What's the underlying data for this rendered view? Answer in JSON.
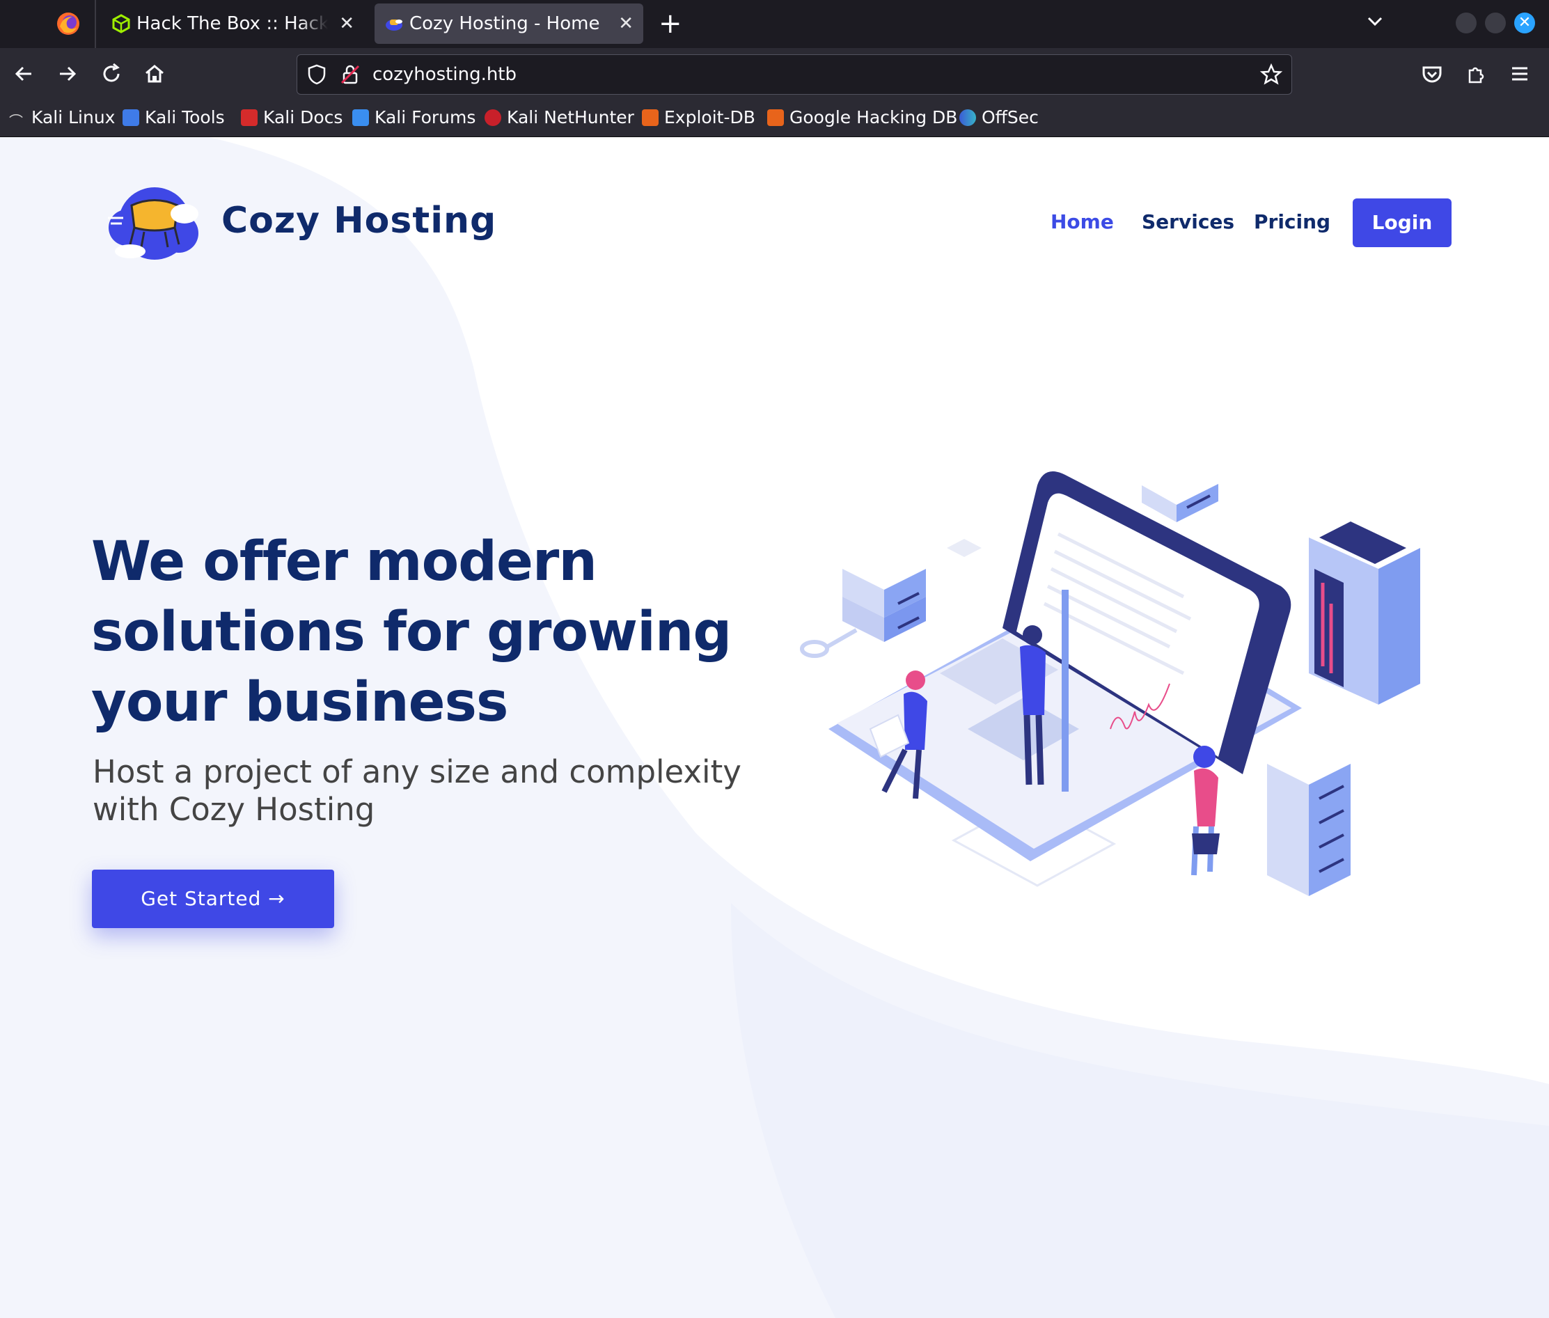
{
  "browser": {
    "tabs": [
      {
        "title": "Hack The Box :: Hack The Box",
        "active": false
      },
      {
        "title": "Cozy Hosting - Home",
        "active": true
      }
    ],
    "tab_close": "✕",
    "new_tab": "+",
    "url": "cozyhosting.htb",
    "bookmarks": [
      {
        "label": "Kali Linux",
        "icon": "kali-dragon-icon"
      },
      {
        "label": "Kali Tools",
        "icon": "kali-tools-icon"
      },
      {
        "label": "Kali Docs",
        "icon": "kali-docs-icon"
      },
      {
        "label": "Kali Forums",
        "icon": "kali-forums-icon"
      },
      {
        "label": "Kali NetHunter",
        "icon": "nethunter-icon"
      },
      {
        "label": "Exploit-DB",
        "icon": "exploit-db-icon"
      },
      {
        "label": "Google Hacking DB",
        "icon": "ghdb-icon"
      },
      {
        "label": "OffSec",
        "icon": "offsec-icon"
      }
    ]
  },
  "site": {
    "brand": "Cozy Hosting",
    "nav": {
      "home": "Home",
      "services": "Services",
      "pricing": "Pricing",
      "login": "Login"
    },
    "hero": {
      "title": "We offer modern solutions for growing your business",
      "subtitle": "Host a project of any size and complexity with Cozy Hosting",
      "cta": "Get Started →"
    }
  },
  "colors": {
    "primary": "#3f48e6",
    "heading": "#0f2a6b",
    "chrome_dark": "#1c1b22",
    "chrome_mid": "#2b2a33"
  }
}
